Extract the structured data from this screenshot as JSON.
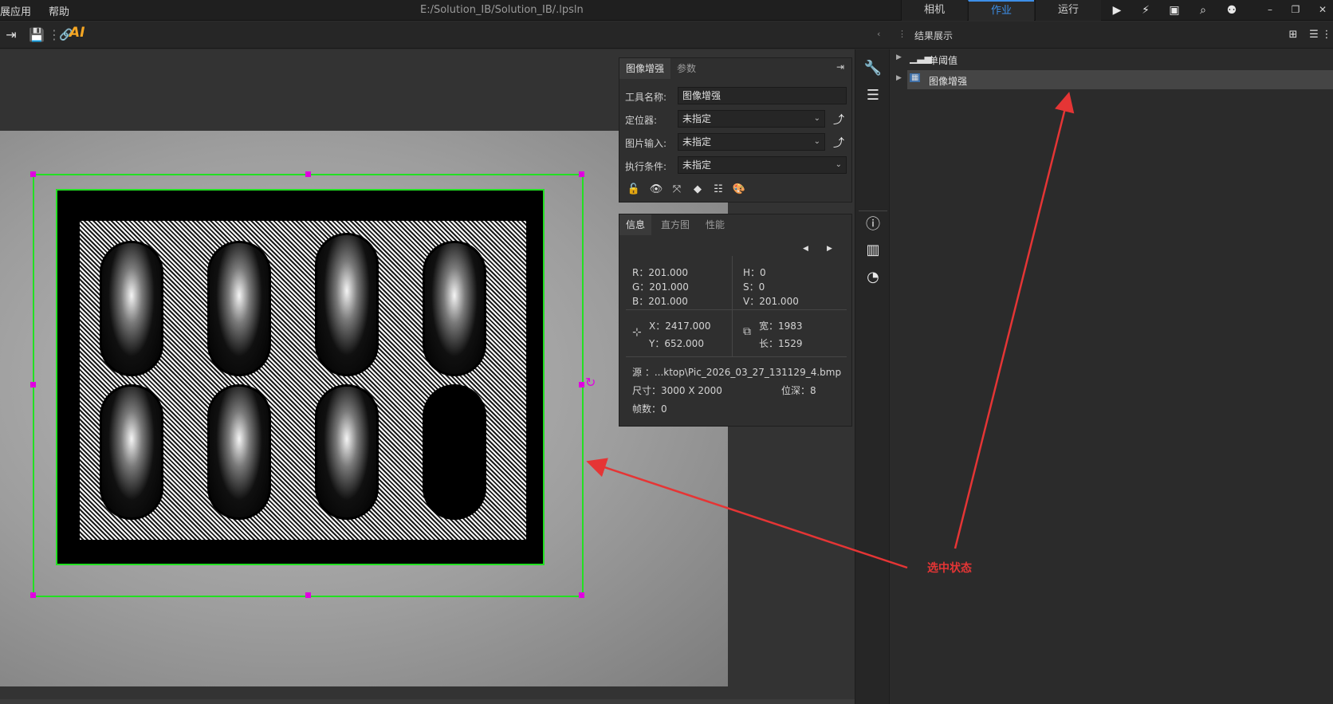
{
  "menu": {
    "items": [
      "展应用",
      "帮助"
    ]
  },
  "window": {
    "title": "E:/Solution_IB/Solution_IB/.lpsln"
  },
  "modes": {
    "tabs": [
      "相机",
      "作业",
      "运行"
    ],
    "active": "作业"
  },
  "toolbar": {
    "ai_label": "AI"
  },
  "results": {
    "title": "结果展示",
    "tree": [
      {
        "label": "单阈值",
        "icon": "histogram-icon",
        "selected": false
      },
      {
        "label": "图像增强",
        "icon": "image-icon",
        "selected": true
      }
    ]
  },
  "tool_panel": {
    "tabs": [
      "图像增强",
      "参数"
    ],
    "fields": {
      "tool_name": {
        "label": "工具名称:",
        "value": "图像增强"
      },
      "locator": {
        "label": "定位器:",
        "value": "未指定"
      },
      "image_input": {
        "label": "图片输入:",
        "value": "未指定"
      },
      "exec_condition": {
        "label": "执行条件:",
        "value": "未指定"
      }
    }
  },
  "info_panel": {
    "tabs": [
      "信息",
      "直方图",
      "性能"
    ],
    "rgb": {
      "r": "R：201.000",
      "g": "G：201.000",
      "b": "B：201.000"
    },
    "hsv": {
      "h": "H：0",
      "s": "S：0",
      "v": "V：201.000"
    },
    "pos": {
      "x": "X：2417.000",
      "y": "Y：652.000"
    },
    "size": {
      "w": "宽：1983",
      "h": "长：1529"
    },
    "source": "源   ：...ktop\\Pic_2026_03_27_131129_4.bmp",
    "dimension": "尺寸：3000 X 2000",
    "bitdepth": "位深：8",
    "frames": "帧数：0"
  },
  "annotation": {
    "label": "选中状态",
    "color": "#e53535"
  },
  "colors": {
    "accent": "#3d8fe8",
    "roi": "#22e022",
    "handle": "#e000e0"
  }
}
